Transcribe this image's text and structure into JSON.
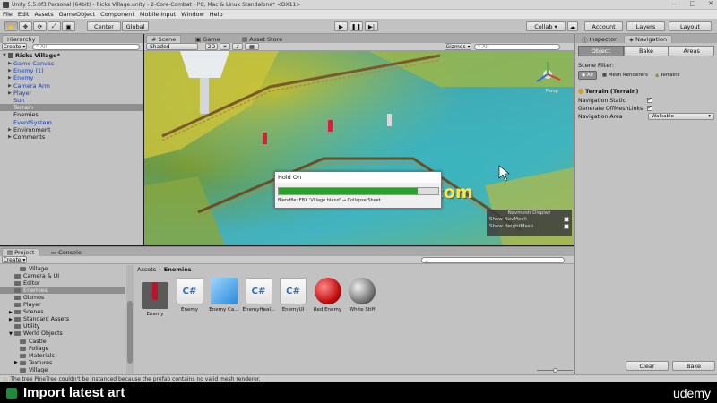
{
  "window": {
    "title": "Unity 5.5.0f3 Personal (64bit) - Ricks Village.unity - 2-Core-Combat - PC, Mac & Linux Standalone* <DX11>",
    "controls": [
      "—",
      "□",
      "✕"
    ]
  },
  "menu": [
    "File",
    "Edit",
    "Assets",
    "GameObject",
    "Component",
    "Mobile Input",
    "Window",
    "Help"
  ],
  "toolbar": {
    "pivot": "Center",
    "space": "Global",
    "collab": "Collab ▾",
    "account": "Account",
    "layers": "Layers",
    "layout": "Layout"
  },
  "hierarchy": {
    "tab": "Hierarchy",
    "create": "Create ▾",
    "search_placeholder": "All",
    "scene": "Ricks Village*",
    "items": [
      {
        "label": "Game Canvas",
        "arrow": "▶",
        "indent": 1,
        "color": "#1a3fb0"
      },
      {
        "label": "Enemy (1)",
        "arrow": "▶",
        "indent": 1,
        "color": "#1a3fb0"
      },
      {
        "label": "Enemy",
        "arrow": "▶",
        "indent": 1,
        "color": "#1a3fb0"
      },
      {
        "label": "Camera Arm",
        "arrow": "▶",
        "indent": 1,
        "color": "#1a3fb0"
      },
      {
        "label": "Player",
        "arrow": "▶",
        "indent": 1,
        "color": "#1a3fb0"
      },
      {
        "label": "Sun",
        "arrow": "",
        "indent": 1,
        "color": "#1a3fb0"
      },
      {
        "label": "Terrain",
        "arrow": "",
        "indent": 1,
        "color": "#f2f2f2",
        "selected": true
      },
      {
        "label": "Enemies",
        "arrow": "",
        "indent": 1,
        "color": "#111111"
      },
      {
        "label": "EventSystem",
        "arrow": "",
        "indent": 1,
        "color": "#1a3fb0"
      },
      {
        "label": "Environment",
        "arrow": "▶",
        "indent": 1,
        "color": "#111111"
      },
      {
        "label": "Comments",
        "arrow": "▶",
        "indent": 1,
        "color": "#111111"
      }
    ]
  },
  "scene": {
    "tabs": [
      "Scene",
      "Game",
      "Asset Store"
    ],
    "shading": "Shaded",
    "mode2d": "2D",
    "gizmos": "Gizmos ▾",
    "search_placeholder": "All",
    "persp_label": "Persp",
    "navmesh": {
      "title": "Navmesh Display",
      "show_navmesh": "Show NavMesh",
      "show_heightmesh": "Show HeightMesh",
      "show_navmesh_checked": "✓",
      "show_heightmesh_checked": ""
    },
    "dialog": {
      "title": "Hold On",
      "message": "Blendfle: FBX 'Village.blend' → Collapse Sheet",
      "progress": 0.87,
      "progress_color": "#2aa02a"
    },
    "watermark": "www.cgtsj.com"
  },
  "inspector": {
    "tabs": [
      "Inspector",
      "Navigation"
    ],
    "subtabs": [
      "Object",
      "Bake",
      "Areas"
    ],
    "scene_filter_label": "Scene Filter:",
    "filters": [
      "All",
      "Mesh Renderers",
      "Terrains"
    ],
    "object_name": "Terrain (Terrain)",
    "navigation_static_label": "Navigation Static",
    "navigation_static_checked": "✓",
    "offmesh_label": "Generate OffMeshLinks",
    "offmesh_checked": "✓",
    "area_label": "Navigation Area",
    "area_value": "Walkable",
    "clear": "Clear",
    "bake": "Bake"
  },
  "project": {
    "tabs": [
      "Project",
      "Console"
    ],
    "create": "Create ▾",
    "tree": [
      {
        "label": "Village",
        "indent": 2
      },
      {
        "label": "Camera & UI",
        "indent": 1
      },
      {
        "label": "Editor",
        "indent": 1
      },
      {
        "label": "Enemies",
        "indent": 1,
        "selected": true
      },
      {
        "label": "Gizmos",
        "indent": 1
      },
      {
        "label": "Player",
        "indent": 1
      },
      {
        "label": "Scenes",
        "indent": 1,
        "arrow": "▶"
      },
      {
        "label": "Standard Assets",
        "indent": 1,
        "arrow": "▶"
      },
      {
        "label": "Utility",
        "indent": 1
      },
      {
        "label": "World Objects",
        "indent": 1,
        "arrow": "▼"
      },
      {
        "label": "Castle",
        "indent": 2
      },
      {
        "label": "Foliage",
        "indent": 2
      },
      {
        "label": "Materials",
        "indent": 2
      },
      {
        "label": "Textures",
        "indent": 2,
        "arrow": "▶"
      },
      {
        "label": "Village",
        "indent": 2
      }
    ],
    "breadcrumb": [
      "Assets",
      "Enemies"
    ],
    "assets": [
      {
        "label": "Enemy",
        "kind": "prefab-char"
      },
      {
        "label": "Enemy",
        "kind": "script"
      },
      {
        "label": "Enemy Ca…",
        "kind": "cube"
      },
      {
        "label": "EnemyHeal…",
        "kind": "script"
      },
      {
        "label": "EnemyUI",
        "kind": "script"
      },
      {
        "label": "Red Enemy",
        "kind": "red-sphere"
      },
      {
        "label": "White Stiff",
        "kind": "white-sphere"
      }
    ]
  },
  "status": {
    "message": "The tree PineTree couldn't be instanced because the prefab contains no valid mesh renderer.",
    "icon": "warning-icon"
  },
  "banner": {
    "title": "Import latest art",
    "brand": "udemy"
  }
}
